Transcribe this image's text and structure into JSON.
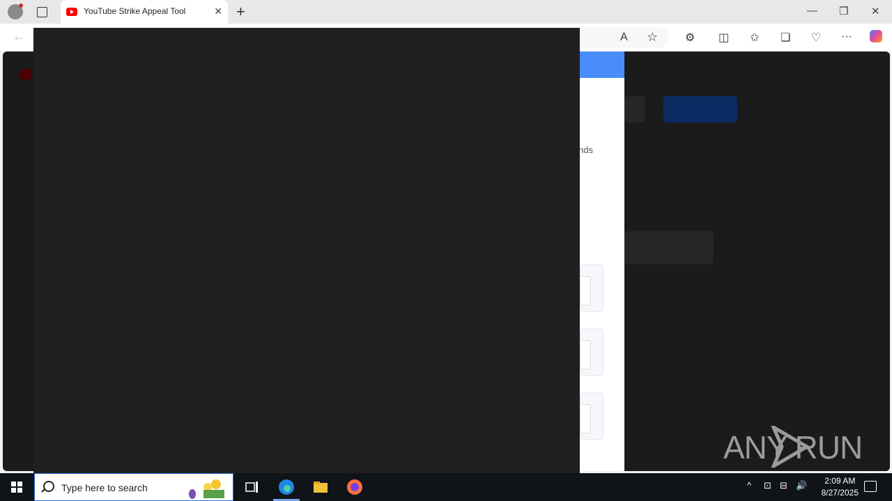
{
  "browser": {
    "tab_title": "YouTube Strike Appeal Tool",
    "tab_close": "✕",
    "new_tab": "+",
    "window_controls": {
      "minimize": "—",
      "restore": "❐",
      "close": "✕"
    },
    "toolbar_icons": {
      "read_aloud": "A",
      "favorite": "☆",
      "extensions": "⚙",
      "split": "◫",
      "favorites": "✩",
      "collections": "❏",
      "browser_essentials": "♡",
      "menu": "···"
    },
    "back": "←"
  },
  "page": {
    "panel_fragment": "nds",
    "watermark": "ANY RUN"
  },
  "taskbar": {
    "search_placeholder": "Type here to search",
    "time": "2:09 AM",
    "date": "8/27/2025",
    "tray_chevron": "^",
    "tray_icons": {
      "meet": "⊡",
      "network": "⊟",
      "volume": "🔊"
    }
  },
  "colors": {
    "accent_blue": "#4a8df8",
    "overlay": "#202020",
    "youtube_red": "#ff0000",
    "taskbar": "#101318"
  }
}
